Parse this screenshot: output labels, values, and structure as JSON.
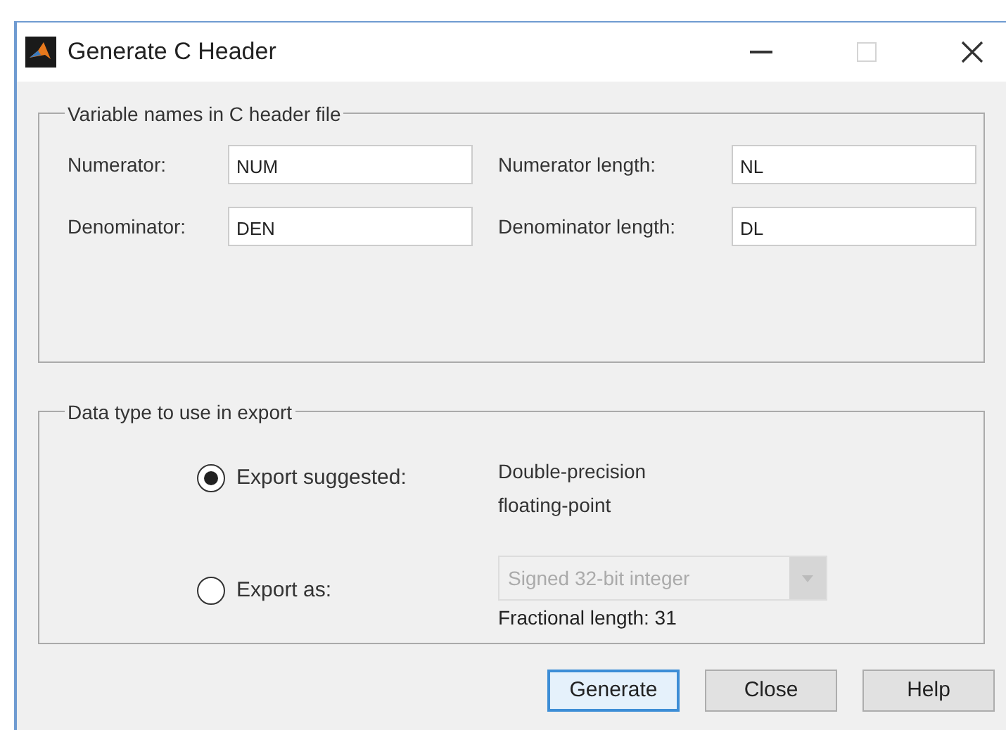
{
  "window": {
    "title": "Generate C Header"
  },
  "variable_names": {
    "legend": "Variable names in C header file",
    "fields": [
      {
        "label": "Numerator:",
        "value": "NUM"
      },
      {
        "label": "Numerator length:",
        "value": "NL"
      },
      {
        "label": "Denominator:",
        "value": "DEN"
      },
      {
        "label": "Denominator length:",
        "value": "DL"
      }
    ]
  },
  "data_type": {
    "legend": "Data type to use in export",
    "options": [
      {
        "kind": "text",
        "label": "Export suggested:",
        "selected": true,
        "lines": [
          "Double-precision",
          "floating-point"
        ]
      },
      {
        "kind": "dropdown",
        "label": "Export as:",
        "selected": false,
        "dropdown": {
          "value": "Signed 32-bit integer",
          "disabled": true
        },
        "note": "Fractional length: 31"
      }
    ]
  },
  "buttons": [
    {
      "label": "Generate",
      "focused": true
    },
    {
      "label": "Close",
      "focused": false
    },
    {
      "label": "Help",
      "focused": false
    }
  ]
}
